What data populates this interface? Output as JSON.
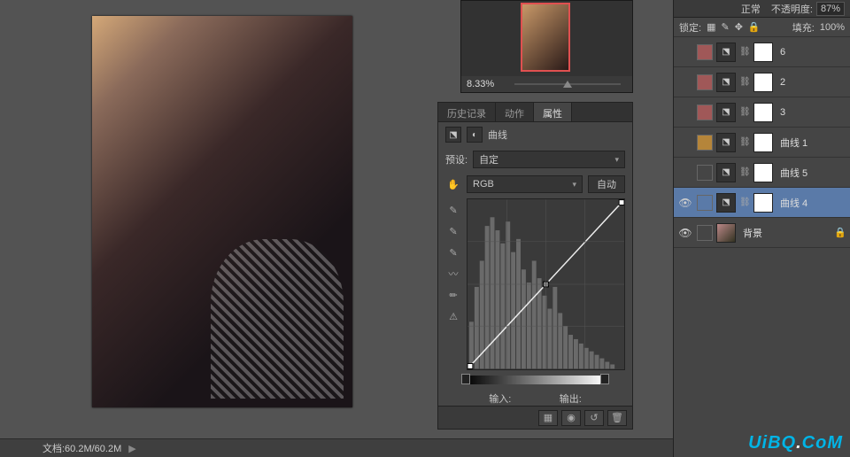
{
  "status": {
    "doc_size": "文档:60.2M/60.2M"
  },
  "navigator": {
    "zoom": "8.33%"
  },
  "properties": {
    "tabs": {
      "history": "历史记录",
      "actions": "动作",
      "props": "属性"
    },
    "title": "曲线",
    "preset_label": "预设:",
    "preset_value": "自定",
    "channel": "RGB",
    "auto": "自动",
    "input": "输入:",
    "output": "输出:"
  },
  "layers_panel": {
    "blend": "正常",
    "opacity_label": "不透明度:",
    "opacity_value": "87%",
    "lock_label": "锁定:",
    "fill_label": "填充:",
    "fill_value": "100%",
    "items": [
      {
        "name": "6",
        "color": "#a05858"
      },
      {
        "name": "2",
        "color": "#a05858"
      },
      {
        "name": "3",
        "color": "#a05858"
      },
      {
        "name": "曲线 1",
        "color": "#b5853a"
      },
      {
        "name": "曲线 5",
        "color": ""
      },
      {
        "name": "曲线 4",
        "color": "",
        "selected": true,
        "visible": true
      },
      {
        "name": "背景",
        "color": "",
        "visible": true,
        "bg": true
      }
    ]
  },
  "watermark": {
    "text": "UiBQ",
    "suffix": "CoM"
  },
  "chart_data": {
    "type": "line",
    "title": "曲线",
    "xlabel": "输入",
    "ylabel": "输出",
    "xlim": [
      0,
      255
    ],
    "ylim": [
      0,
      255
    ],
    "points": [
      [
        0,
        0
      ],
      [
        128,
        128
      ],
      [
        255,
        255
      ]
    ],
    "histogram_peaks": [
      10,
      15,
      22,
      50,
      70,
      60,
      55,
      90,
      120,
      140,
      110,
      85,
      70,
      95,
      80,
      60,
      50,
      45,
      70,
      55,
      40,
      35,
      30,
      28,
      25,
      20,
      18,
      15,
      12,
      10,
      8,
      5
    ]
  }
}
